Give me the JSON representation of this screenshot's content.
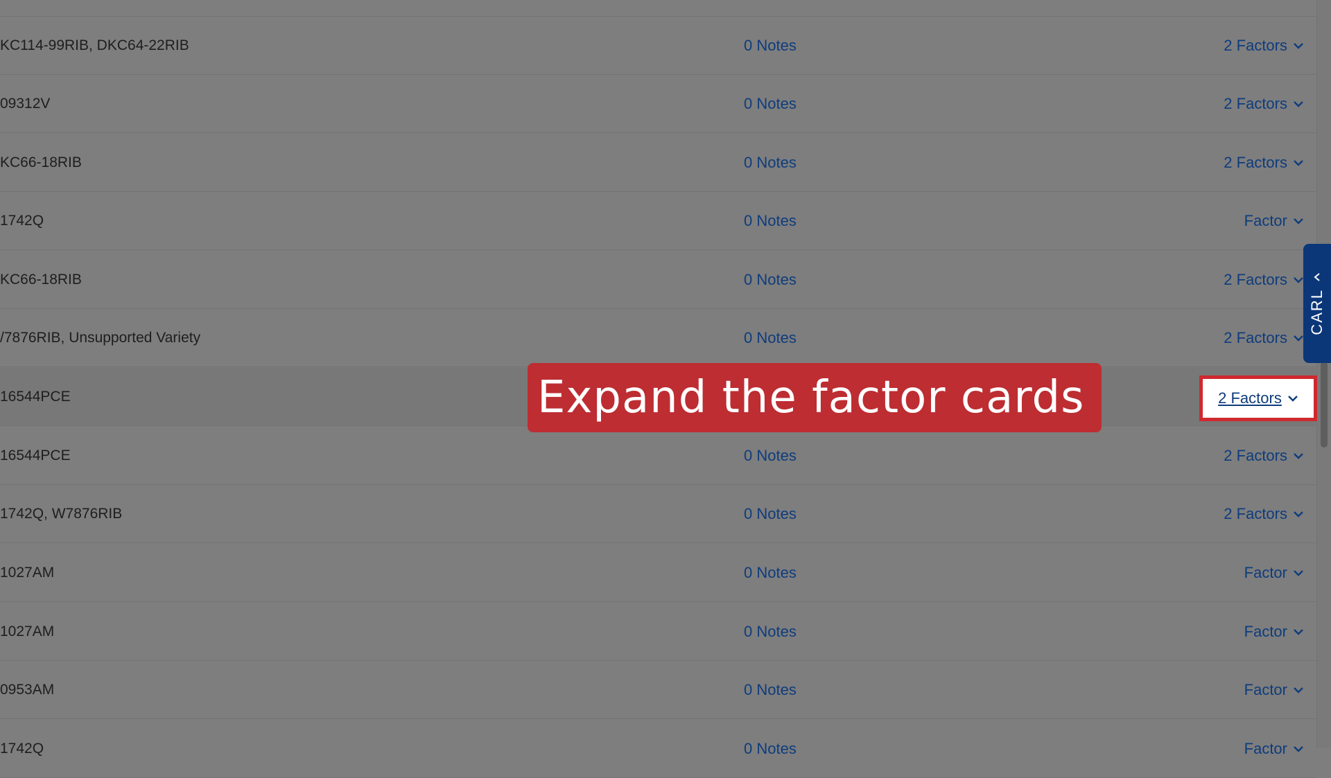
{
  "rows": [
    {
      "varieties": "",
      "notes": "",
      "factors": ""
    },
    {
      "varieties": "KC114-99RIB, DKC64-22RIB",
      "notes": "0 Notes",
      "factors": "2 Factors"
    },
    {
      "varieties": "09312V",
      "notes": "0 Notes",
      "factors": "2 Factors"
    },
    {
      "varieties": "KC66-18RIB",
      "notes": "0 Notes",
      "factors": "2 Factors"
    },
    {
      "varieties": "1742Q",
      "notes": "0 Notes",
      "factors": "Factor"
    },
    {
      "varieties": "KC66-18RIB",
      "notes": "0 Notes",
      "factors": "2 Factors"
    },
    {
      "varieties": "/7876RIB, Unsupported Variety",
      "notes": "0 Notes",
      "factors": "2 Factors"
    },
    {
      "varieties": "16544PCE",
      "notes": "",
      "factors": "2 Factors"
    },
    {
      "varieties": "16544PCE",
      "notes": "0 Notes",
      "factors": "2 Factors"
    },
    {
      "varieties": "1742Q, W7876RIB",
      "notes": "0 Notes",
      "factors": "2 Factors"
    },
    {
      "varieties": "1027AM",
      "notes": "0 Notes",
      "factors": "Factor"
    },
    {
      "varieties": "1027AM",
      "notes": "0 Notes",
      "factors": "Factor"
    },
    {
      "varieties": "0953AM",
      "notes": "0 Notes",
      "factors": "Factor"
    },
    {
      "varieties": "1742Q",
      "notes": "0 Notes",
      "factors": "Factor"
    }
  ],
  "side_tab": {
    "label": "CARL"
  },
  "callout": {
    "text": "Expand the factor cards"
  },
  "highlighted_button": {
    "label": "2 Factors"
  },
  "colors": {
    "overlay": "#7e7e7e",
    "link": "#0e3c7c",
    "callout": "#bd2d32",
    "side_tab": "#0b3779"
  }
}
